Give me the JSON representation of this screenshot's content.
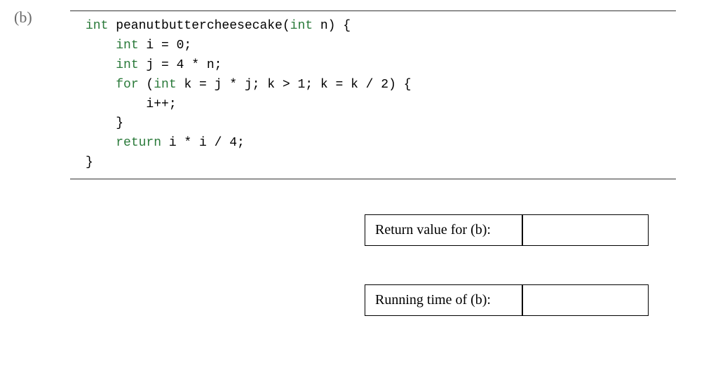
{
  "part_label": "(b)",
  "code": {
    "l1_kw": "int",
    "l1_rest": " peanutbuttercheesecake(",
    "l1_param_kw": "int",
    "l1_param_rest": " n) {",
    "l2_indent": "    ",
    "l2_kw": "int",
    "l2_rest": " i = 0;",
    "l3_indent": "    ",
    "l3_kw": "int",
    "l3_rest": " j = 4 * n;",
    "l4_indent": "    ",
    "l4_kw": "for",
    "l4_rest_a": " (",
    "l4_kw2": "int",
    "l4_rest_b": " k = j * j; k > 1; k = k / 2) {",
    "l5": "        i++;",
    "l6": "    }",
    "l7_indent": "    ",
    "l7_kw": "return",
    "l7_rest": " i * i / 4;",
    "l8": "}"
  },
  "answers": {
    "return_label": "Return value for (b):",
    "return_value": "",
    "runtime_label": "Running time of (b):",
    "runtime_value": ""
  }
}
